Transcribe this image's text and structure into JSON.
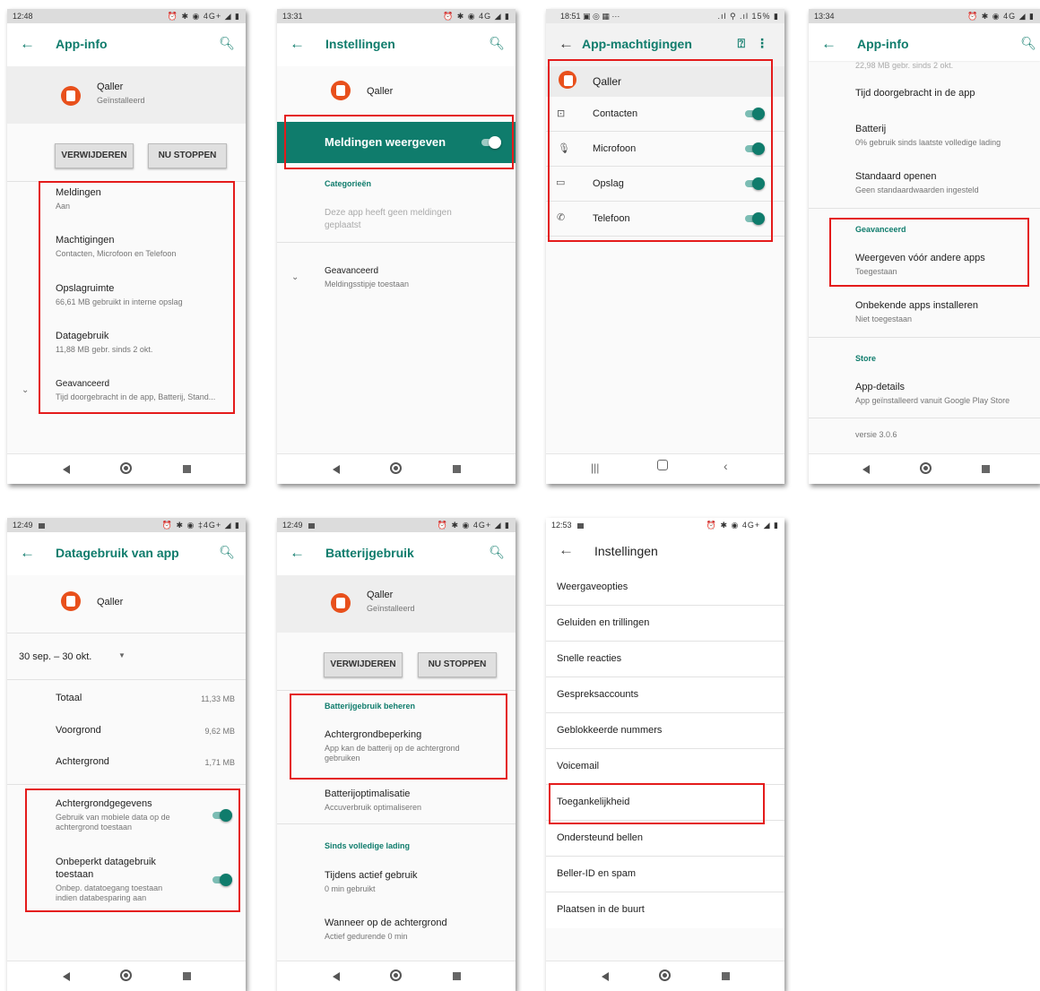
{
  "icons": [
    "back-arrow-icon",
    "search-icon",
    "app-logo-icon",
    "chevron-down-icon",
    "help-icon",
    "more-icon",
    "contacts-icon",
    "microphone-icon",
    "folder-icon",
    "phone-icon",
    "nav-back-icon",
    "nav-home-icon",
    "nav-recents-icon"
  ],
  "colors": {
    "accent": "#0f7c6c",
    "highlight": "#e41b1b",
    "app": "#e8501c"
  },
  "app_name": "Qaller",
  "installed": "Geïnstalleerd",
  "s1": {
    "time": "12:48",
    "status": "⏰ ✱ ◉ 4G+ ◢ ▮",
    "title": "App-info",
    "btn_remove": "VERWIJDEREN",
    "btn_stop": "NU STOPPEN",
    "items": [
      {
        "title": "Meldingen",
        "sub": "Aan"
      },
      {
        "title": "Machtigingen",
        "sub": "Contacten, Microfoon en Telefoon"
      },
      {
        "title": "Opslagruimte",
        "sub": "66,61 MB gebruikt in interne opslag"
      },
      {
        "title": "Datagebruik",
        "sub": "11,88 MB gebr. sinds 2 okt."
      },
      {
        "title": "Geavanceerd",
        "sub": "Tijd doorgebracht in de app, Batterij, Stand..."
      }
    ]
  },
  "s2": {
    "time": "13:31",
    "status": "⏰ ✱ ◉ 4G ◢ ▮",
    "title": "Instellingen",
    "notify": "Meldingen weergeven",
    "categories": "Categorieën",
    "empty1": "Deze app heeft geen meldingen",
    "empty2": "geplaatst",
    "adv_title": "Geavanceerd",
    "adv_sub": "Meldingsstipje toestaan"
  },
  "s3": {
    "time": "18:51",
    "status_left": "▣ ◎ ▦  ···",
    "status": ".ıl ⚲ .ıl 15% ▮",
    "title": "App-machtigingen",
    "items": [
      "Contacten",
      "Microfoon",
      "Opslag",
      "Telefoon"
    ]
  },
  "s4": {
    "time": "13:34",
    "status": "⏰ ✱ ◉ 4G ◢ ▮",
    "title": "App-info",
    "cut": "22,98 MB gebr. sinds 2 okt.",
    "time_spent": "Tijd doorgebracht in de app",
    "battery": "Batterij",
    "battery_sub": "0% gebruik sinds laatste volledige lading",
    "default": "Standaard openen",
    "default_sub": "Geen standaardwaarden ingesteld",
    "advanced": "Geavanceerd",
    "overlay": "Weergeven vóór andere apps",
    "overlay_sub": "Toegestaan",
    "unknown": "Onbekende apps installeren",
    "unknown_sub": "Niet toegestaan",
    "store": "Store",
    "details": "App-details",
    "details_sub": "App geïnstalleerd vanuit Google Play Store",
    "version": "versie 3.0.6"
  },
  "s5": {
    "time": "12:49",
    "status": "⏰ ✱ ◉ ‡4G+ ◢ ▮",
    "title": "Datagebruik van app",
    "range": "30 sep. – 30 okt.",
    "rows": [
      {
        "label": "Totaal",
        "value": "11,33 MB"
      },
      {
        "label": "Voorgrond",
        "value": "9,62 MB"
      },
      {
        "label": "Achtergrond",
        "value": "1,71 MB"
      }
    ],
    "bg_title": "Achtergrondgegevens",
    "bg_sub1": "Gebruik van mobiele data op de",
    "bg_sub2": "achtergrond toestaan",
    "unl_title1": "Onbeperkt datagebruik",
    "unl_title2": "toestaan",
    "unl_sub1": "Onbep. datatoegang toestaan",
    "unl_sub2": "indien databesparing aan"
  },
  "s6": {
    "time": "12:49",
    "status": "⏰ ✱ ◉ 4G+ ◢ ▮",
    "title": "Batterijgebruik",
    "btn_remove": "VERWIJDEREN",
    "btn_stop": "NU STOPPEN",
    "manage": "Batterijgebruik beheren",
    "bgr": "Achtergrondbeperking",
    "bgr_sub1": "App kan de batterij op de achtergrond",
    "bgr_sub2": "gebruiken",
    "opt": "Batterijoptimalisatie",
    "opt_sub": "Accuverbruik optimaliseren",
    "since": "Sinds volledige lading",
    "active": "Tijdens actief gebruik",
    "active_sub": "0 min gebruikt",
    "bg": "Wanneer op de achtergrond",
    "bg_sub": "Actief gedurende 0 min"
  },
  "s7": {
    "time": "12:53",
    "status": "⏰ ✱ ◉ 4G+ ◢ ▮",
    "title": "Instellingen",
    "items": [
      "Weergaveopties",
      "Geluiden en trillingen",
      "Snelle reacties",
      "Gespreksaccounts",
      "Geblokkeerde nummers",
      "Voicemail",
      "Toegankelijkheid",
      "Ondersteund bellen",
      "Beller-ID en spam",
      "Plaatsen in de buurt"
    ]
  }
}
